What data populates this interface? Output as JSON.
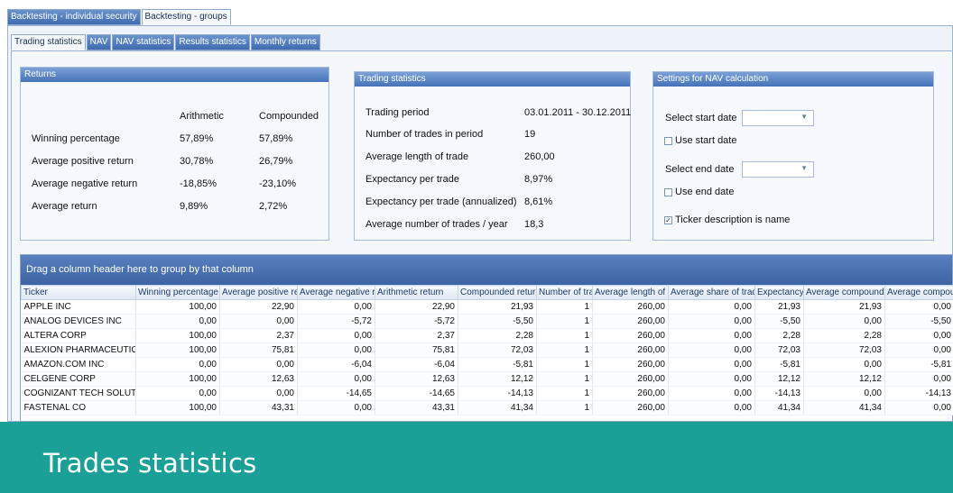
{
  "outer_tabs": [
    "Backtesting - individual security",
    "Backtesting - groups"
  ],
  "inner_tabs": [
    "Trading statistics",
    "NAV",
    "NAV statistics",
    "Results statistics",
    "Monthly returns"
  ],
  "returns_panel": {
    "title": "Returns",
    "col_headers": [
      "Arithmetic",
      "Compounded"
    ],
    "rows": [
      {
        "label": "Winning percentage",
        "arithmetic": "57,89%",
        "compounded": "57,89%"
      },
      {
        "label": "Average positive return",
        "arithmetic": "30,78%",
        "compounded": "26,79%"
      },
      {
        "label": "Average negative return",
        "arithmetic": "-18,85%",
        "compounded": "-23,10%"
      },
      {
        "label": "Average return",
        "arithmetic": "9,89%",
        "compounded": "2,72%"
      }
    ]
  },
  "trading_panel": {
    "title": "Trading statistics",
    "rows": [
      {
        "label": "Trading period",
        "value": "03.01.2011 - 30.12.2011"
      },
      {
        "label": "Number of trades in period",
        "value": "19"
      },
      {
        "label": "Average length of trade",
        "value": "260,00"
      },
      {
        "label": "Expectancy per trade",
        "value": "8,97%"
      },
      {
        "label": "Expectancy per trade (annualized)",
        "value": "8,61%"
      },
      {
        "label": "Average number of trades / year",
        "value": "18,3"
      }
    ]
  },
  "settings_panel": {
    "title": "Settings for NAV calculation",
    "start_label": "Select start date",
    "start_value": "",
    "use_start": "Use start date",
    "use_start_checked": false,
    "end_label": "Select end date",
    "end_value": "",
    "use_end": "Use end date",
    "use_end_checked": false,
    "ticker_desc": "Ticker description is name",
    "ticker_desc_checked": true
  },
  "grid": {
    "group_hint": "Drag a column header here to group by that column",
    "columns": [
      "Ticker",
      "Winning percentage",
      "Average positive ret",
      "Average negative retu",
      "Arithmetic return",
      "Compounded return",
      "Number of trad",
      "Average length of tr",
      "Average share of traded",
      "Expectancy",
      "Average compounded",
      "Average compoun"
    ],
    "rows": [
      [
        "APPLE INC",
        "100,00",
        "22,90",
        "0,00",
        "22,90",
        "21,93",
        "1",
        "260,00",
        "0,00",
        "21,93",
        "21,93",
        "0,00"
      ],
      [
        "ANALOG DEVICES INC",
        "0,00",
        "0,00",
        "-5,72",
        "-5,72",
        "-5,50",
        "1",
        "260,00",
        "0,00",
        "-5,50",
        "0,00",
        "-5,50"
      ],
      [
        "ALTERA CORP",
        "100,00",
        "2,37",
        "0,00",
        "2,37",
        "2,28",
        "1",
        "260,00",
        "0,00",
        "2,28",
        "2,28",
        "0,00"
      ],
      [
        "ALEXION PHARMACEUTICALS IN",
        "100,00",
        "75,81",
        "0,00",
        "75,81",
        "72,03",
        "1",
        "260,00",
        "0,00",
        "72,03",
        "72,03",
        "0,00"
      ],
      [
        "AMAZON.COM INC",
        "0,00",
        "0,00",
        "-6,04",
        "-6,04",
        "-5,81",
        "1",
        "260,00",
        "0,00",
        "-5,81",
        "0,00",
        "-5,81"
      ],
      [
        "CELGENE CORP",
        "100,00",
        "12,63",
        "0,00",
        "12,63",
        "12,12",
        "1",
        "260,00",
        "0,00",
        "12,12",
        "12,12",
        "0,00"
      ],
      [
        "COGNIZANT TECH SOLUTIONS-",
        "0,00",
        "0,00",
        "-14,65",
        "-14,65",
        "-14,13",
        "1",
        "260,00",
        "0,00",
        "-14,13",
        "0,00",
        "-14,13"
      ],
      [
        "FASTENAL CO",
        "100,00",
        "43,31",
        "0,00",
        "43,31",
        "41,34",
        "1",
        "260,00",
        "0,00",
        "41,34",
        "41,34",
        "0,00"
      ]
    ]
  },
  "banner": {
    "title": "Trades statistics"
  },
  "colors": {
    "accent_teal": "#1aa097",
    "header_blue": "#4573b8"
  }
}
